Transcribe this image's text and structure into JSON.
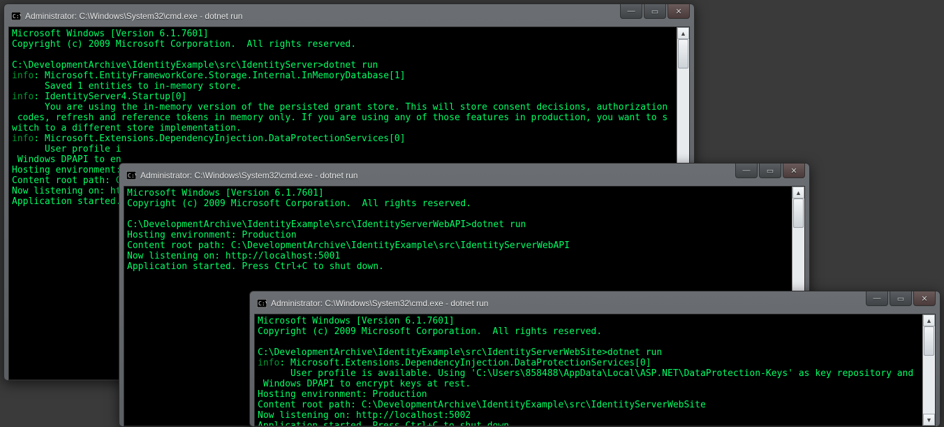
{
  "windows": [
    {
      "id": "w1",
      "title": "Administrator: C:\\Windows\\System32\\cmd.exe - dotnet  run",
      "lines": [
        {
          "t": "Microsoft Windows [Version 6.1.7601]"
        },
        {
          "t": "Copyright (c) 2009 Microsoft Corporation.  All rights reserved."
        },
        {
          "t": ""
        },
        {
          "t": "C:\\DevelopmentArchive\\IdentityExample\\src\\IdentityServer>dotnet run"
        },
        {
          "tag": "info",
          "t": ": Microsoft.EntityFrameworkCore.Storage.Internal.InMemoryDatabase[1]"
        },
        {
          "t": "      Saved 1 entities to in-memory store."
        },
        {
          "tag": "info",
          "t": ": IdentityServer4.Startup[0]"
        },
        {
          "t": "      You are using the in-memory version of the persisted grant store. This will store consent decisions, authorization"
        },
        {
          "t": " codes, refresh and reference tokens in memory only. If you are using any of those features in production, you want to s"
        },
        {
          "t": "witch to a different store implementation."
        },
        {
          "tag": "info",
          "t": ": Microsoft.Extensions.DependencyInjection.DataProtectionServices[0]"
        },
        {
          "t": "      User profile i"
        },
        {
          "t": " Windows DPAPI to en"
        },
        {
          "t": "Hosting environment:"
        },
        {
          "t": "Content root path: C"
        },
        {
          "t": "Now listening on: ht"
        },
        {
          "t": "Application started."
        }
      ]
    },
    {
      "id": "w2",
      "title": "Administrator: C:\\Windows\\System32\\cmd.exe - dotnet  run",
      "lines": [
        {
          "t": "Microsoft Windows [Version 6.1.7601]"
        },
        {
          "t": "Copyright (c) 2009 Microsoft Corporation.  All rights reserved."
        },
        {
          "t": ""
        },
        {
          "t": "C:\\DevelopmentArchive\\IdentityExample\\src\\IdentityServerWebAPI>dotnet run"
        },
        {
          "t": "Hosting environment: Production"
        },
        {
          "t": "Content root path: C:\\DevelopmentArchive\\IdentityExample\\src\\IdentityServerWebAPI"
        },
        {
          "t": "Now listening on: http://localhost:5001"
        },
        {
          "t": "Application started. Press Ctrl+C to shut down."
        }
      ]
    },
    {
      "id": "w3",
      "title": "Administrator: C:\\Windows\\System32\\cmd.exe - dotnet  run",
      "lines": [
        {
          "t": "Microsoft Windows [Version 6.1.7601]"
        },
        {
          "t": "Copyright (c) 2009 Microsoft Corporation.  All rights reserved."
        },
        {
          "t": ""
        },
        {
          "t": "C:\\DevelopmentArchive\\IdentityExample\\src\\IdentityServerWebSite>dotnet run"
        },
        {
          "tag": "info",
          "t": ": Microsoft.Extensions.DependencyInjection.DataProtectionServices[0]"
        },
        {
          "t": "      User profile is available. Using 'C:\\Users\\858488\\AppData\\Local\\ASP.NET\\DataProtection-Keys' as key repository and"
        },
        {
          "t": " Windows DPAPI to encrypt keys at rest."
        },
        {
          "t": "Hosting environment: Production"
        },
        {
          "t": "Content root path: C:\\DevelopmentArchive\\IdentityExample\\src\\IdentityServerWebSite"
        },
        {
          "t": "Now listening on: http://localhost:5002"
        },
        {
          "t": "Application started. Press Ctrl+C to shut down."
        }
      ]
    }
  ]
}
